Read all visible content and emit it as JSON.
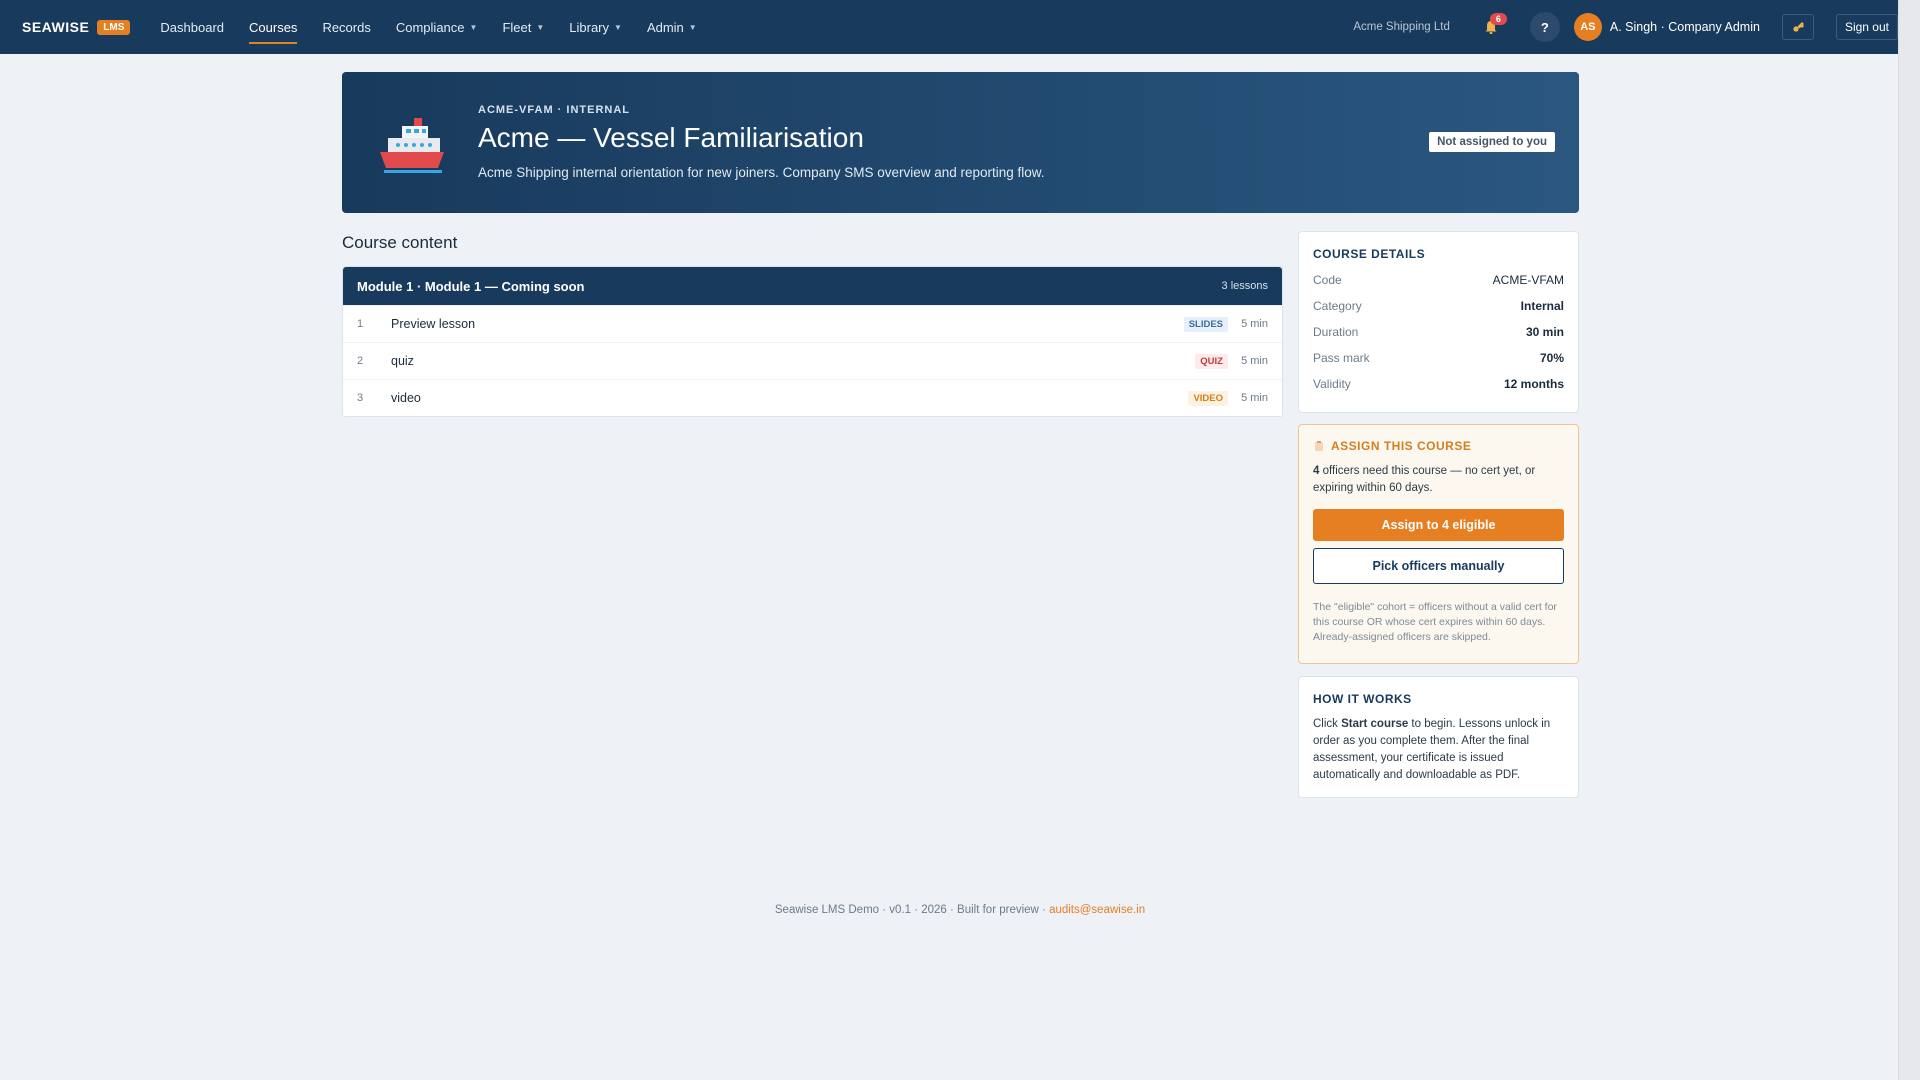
{
  "header": {
    "brand": "SEAWISE",
    "brand_badge": "LMS",
    "nav": [
      {
        "label": "Dashboard"
      },
      {
        "label": "Courses"
      },
      {
        "label": "Records"
      },
      {
        "label": "Compliance"
      },
      {
        "label": "Fleet"
      },
      {
        "label": "Library"
      },
      {
        "label": "Admin"
      }
    ],
    "company": "Acme Shipping Ltd",
    "notification_count": "6",
    "help": "?",
    "avatar_initials": "AS",
    "user_name": "A. Singh · Company Admin",
    "sign_out": "Sign out"
  },
  "hero": {
    "code": "ACME-VFAM · INTERNAL",
    "title": "Acme — Vessel Familiarisation",
    "description": "Acme Shipping internal orientation for new joiners. Company SMS overview and reporting flow.",
    "status_pill": "Not assigned to you"
  },
  "content": {
    "section_title": "Course content",
    "module": {
      "title": "Module 1 · Module 1 — Coming soon",
      "lesson_count": "3 lessons",
      "lessons": [
        {
          "num": "1",
          "title": "Preview lesson",
          "type": "SLIDES",
          "duration": "5 min"
        },
        {
          "num": "2",
          "title": "quiz",
          "type": "QUIZ",
          "duration": "5 min"
        },
        {
          "num": "3",
          "title": "video",
          "type": "VIDEO",
          "duration": "5 min"
        }
      ]
    }
  },
  "details": {
    "title": "COURSE DETAILS",
    "rows": [
      {
        "label": "Code",
        "value": "ACME-VFAM"
      },
      {
        "label": "Category",
        "value": "Internal"
      },
      {
        "label": "Duration",
        "value": "30 min"
      },
      {
        "label": "Pass mark",
        "value": "70%"
      },
      {
        "label": "Validity",
        "value": "12 months"
      }
    ]
  },
  "assign": {
    "title": "ASSIGN THIS COURSE",
    "count": "4",
    "text": "officers need this course — no cert yet, or expiring within 60 days.",
    "primary_button": "Assign to 4 eligible",
    "secondary_button": "Pick officers manually",
    "note": "The \"eligible\" cohort = officers without a valid cert for this course OR whose cert expires within 60 days. Already-assigned officers are skipped."
  },
  "how": {
    "title": "HOW IT WORKS",
    "text_pre": "Click ",
    "text_bold": "Start course",
    "text_post": " to begin. Lessons unlock in order as you complete them. After the final assessment, your certificate is issued automatically and downloadable as PDF."
  },
  "footer": {
    "text": "Seawise LMS Demo · v0.1 · 2026 · Built for preview · ",
    "email": "audits@seawise.in"
  }
}
